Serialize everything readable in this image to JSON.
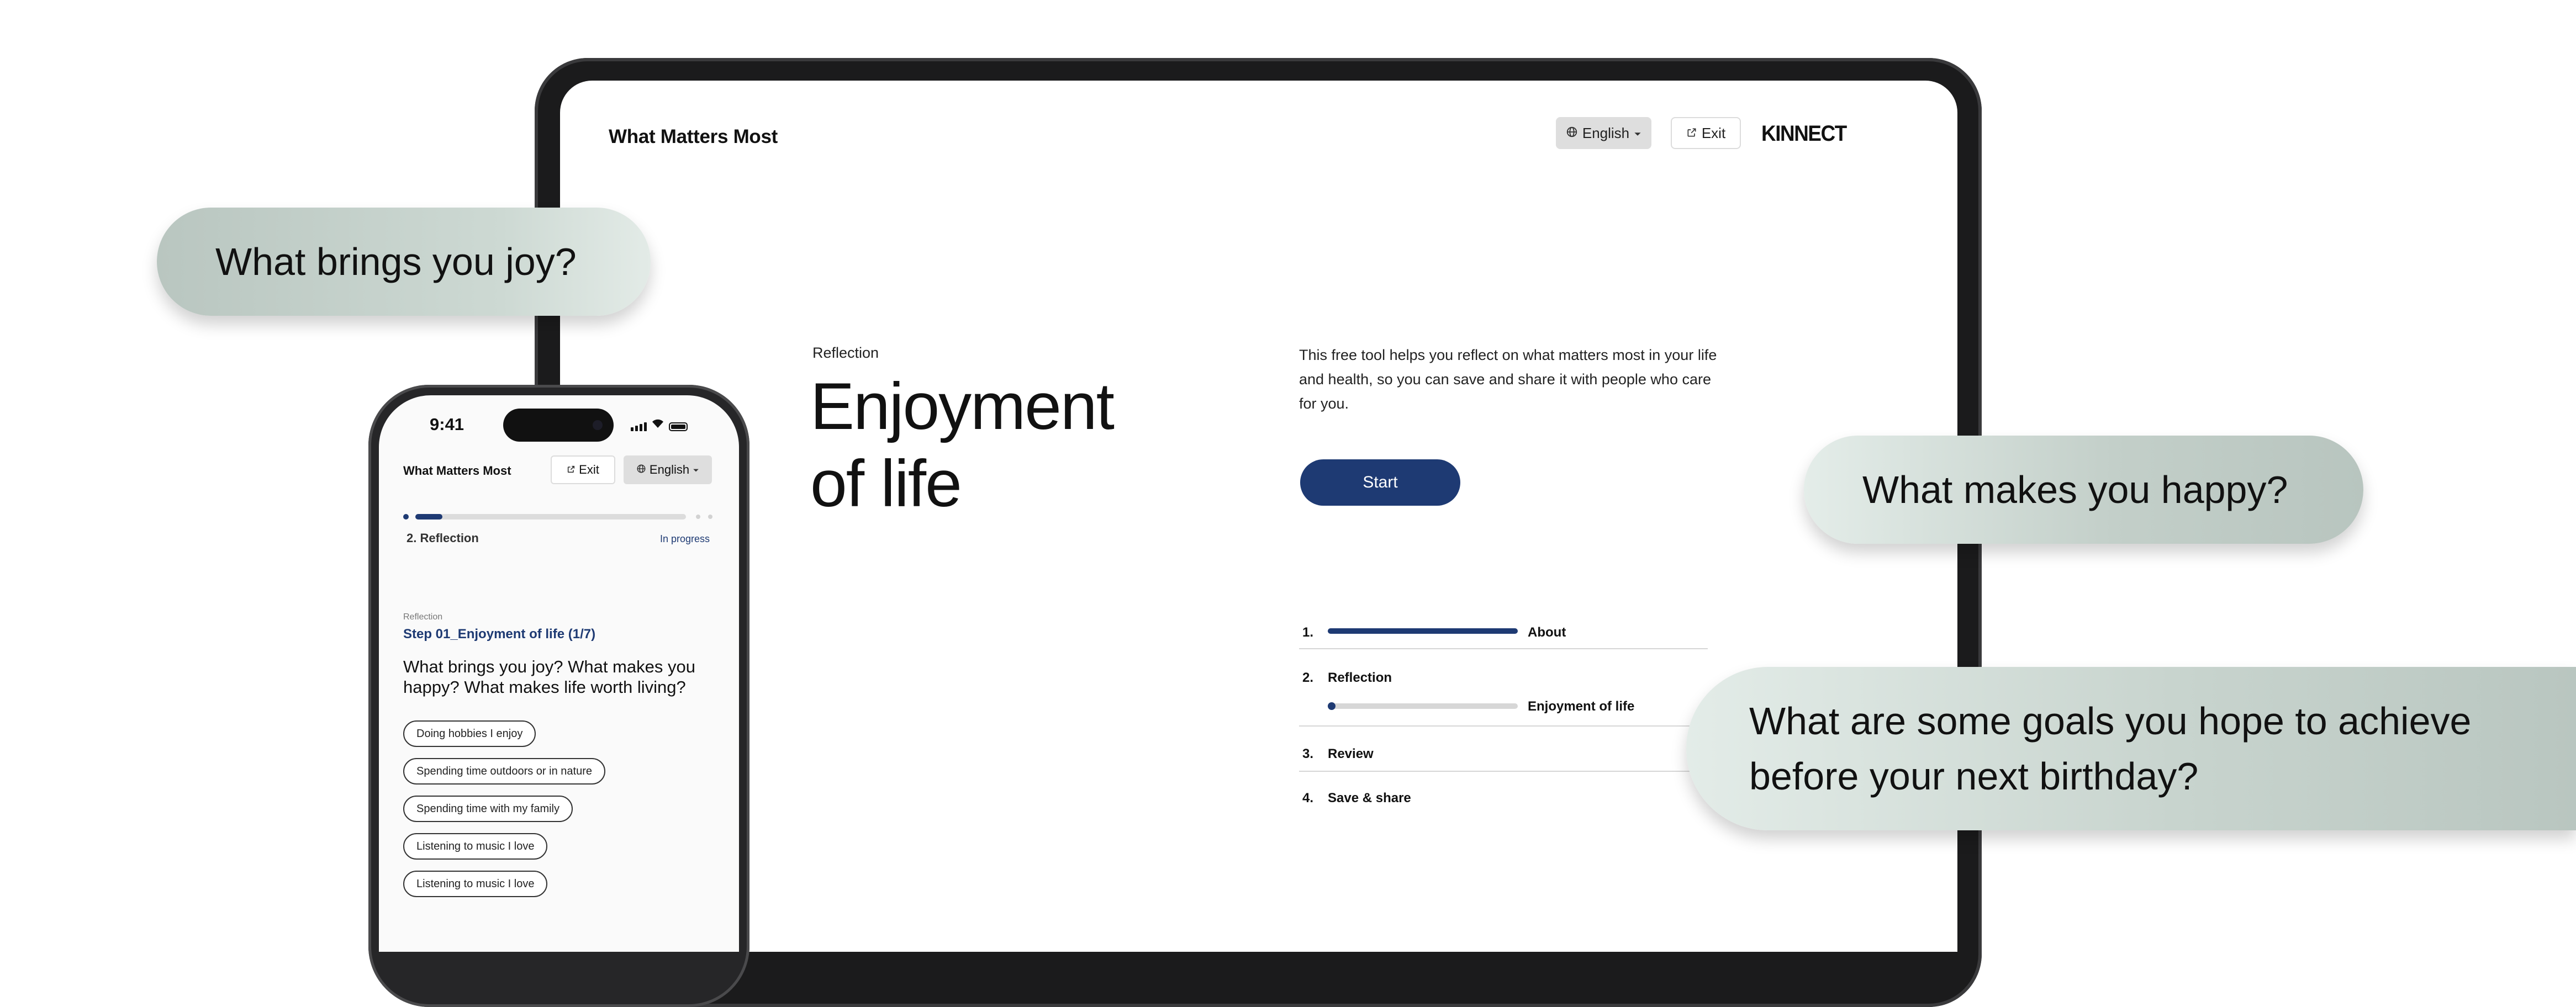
{
  "tablet": {
    "header": {
      "title": "What Matters Most",
      "language": "English",
      "exit_label": "Exit",
      "brand": "KINNECT"
    },
    "section_label": "Reflection",
    "hero_title_line1": "Enjoyment",
    "hero_title_line2": "of life",
    "description": "This free tool helps you reflect on what matters most in your life and health, so you can save and share it with people who care for you.",
    "start_label": "Start",
    "steps": [
      {
        "number": "1.",
        "label": "About",
        "progress": 1.0
      },
      {
        "number": "2.",
        "label": "Reflection",
        "sublabel": "Enjoyment of life",
        "progress": 0.0
      },
      {
        "number": "3.",
        "label": "Review"
      },
      {
        "number": "4.",
        "label": "Save & share"
      }
    ]
  },
  "bubbles": {
    "joy": "What brings you joy?",
    "happy": "What makes you happy?",
    "goals_line1": "What are some goals you hope to achieve",
    "goals_line2": "before your next birthday?"
  },
  "phone": {
    "status_time": "9:41",
    "header": {
      "title": "What Matters Most",
      "exit_label": "Exit",
      "language": "English"
    },
    "progress": {
      "value": 0.1,
      "step_label": "2. Reflection",
      "status": "In progress"
    },
    "section_label": "Reflection",
    "step_title": "Step 01_Enjoyment of life (1/7)",
    "question": "What brings you joy? What makes you happy? What makes life worth living?",
    "chips": [
      "Doing hobbies I enjoy",
      "Spending time outdoors or in nature",
      "Spending time with my family",
      "Listening to music I love",
      "Listening to music I love"
    ]
  },
  "colors": {
    "accent": "#1e3a73",
    "bubble": "#c3cfc9",
    "device": "#1b1b1c"
  },
  "icons": [
    "globe-icon",
    "caret-down-icon",
    "external-link-icon",
    "signal-icon",
    "wifi-icon",
    "battery-icon"
  ]
}
